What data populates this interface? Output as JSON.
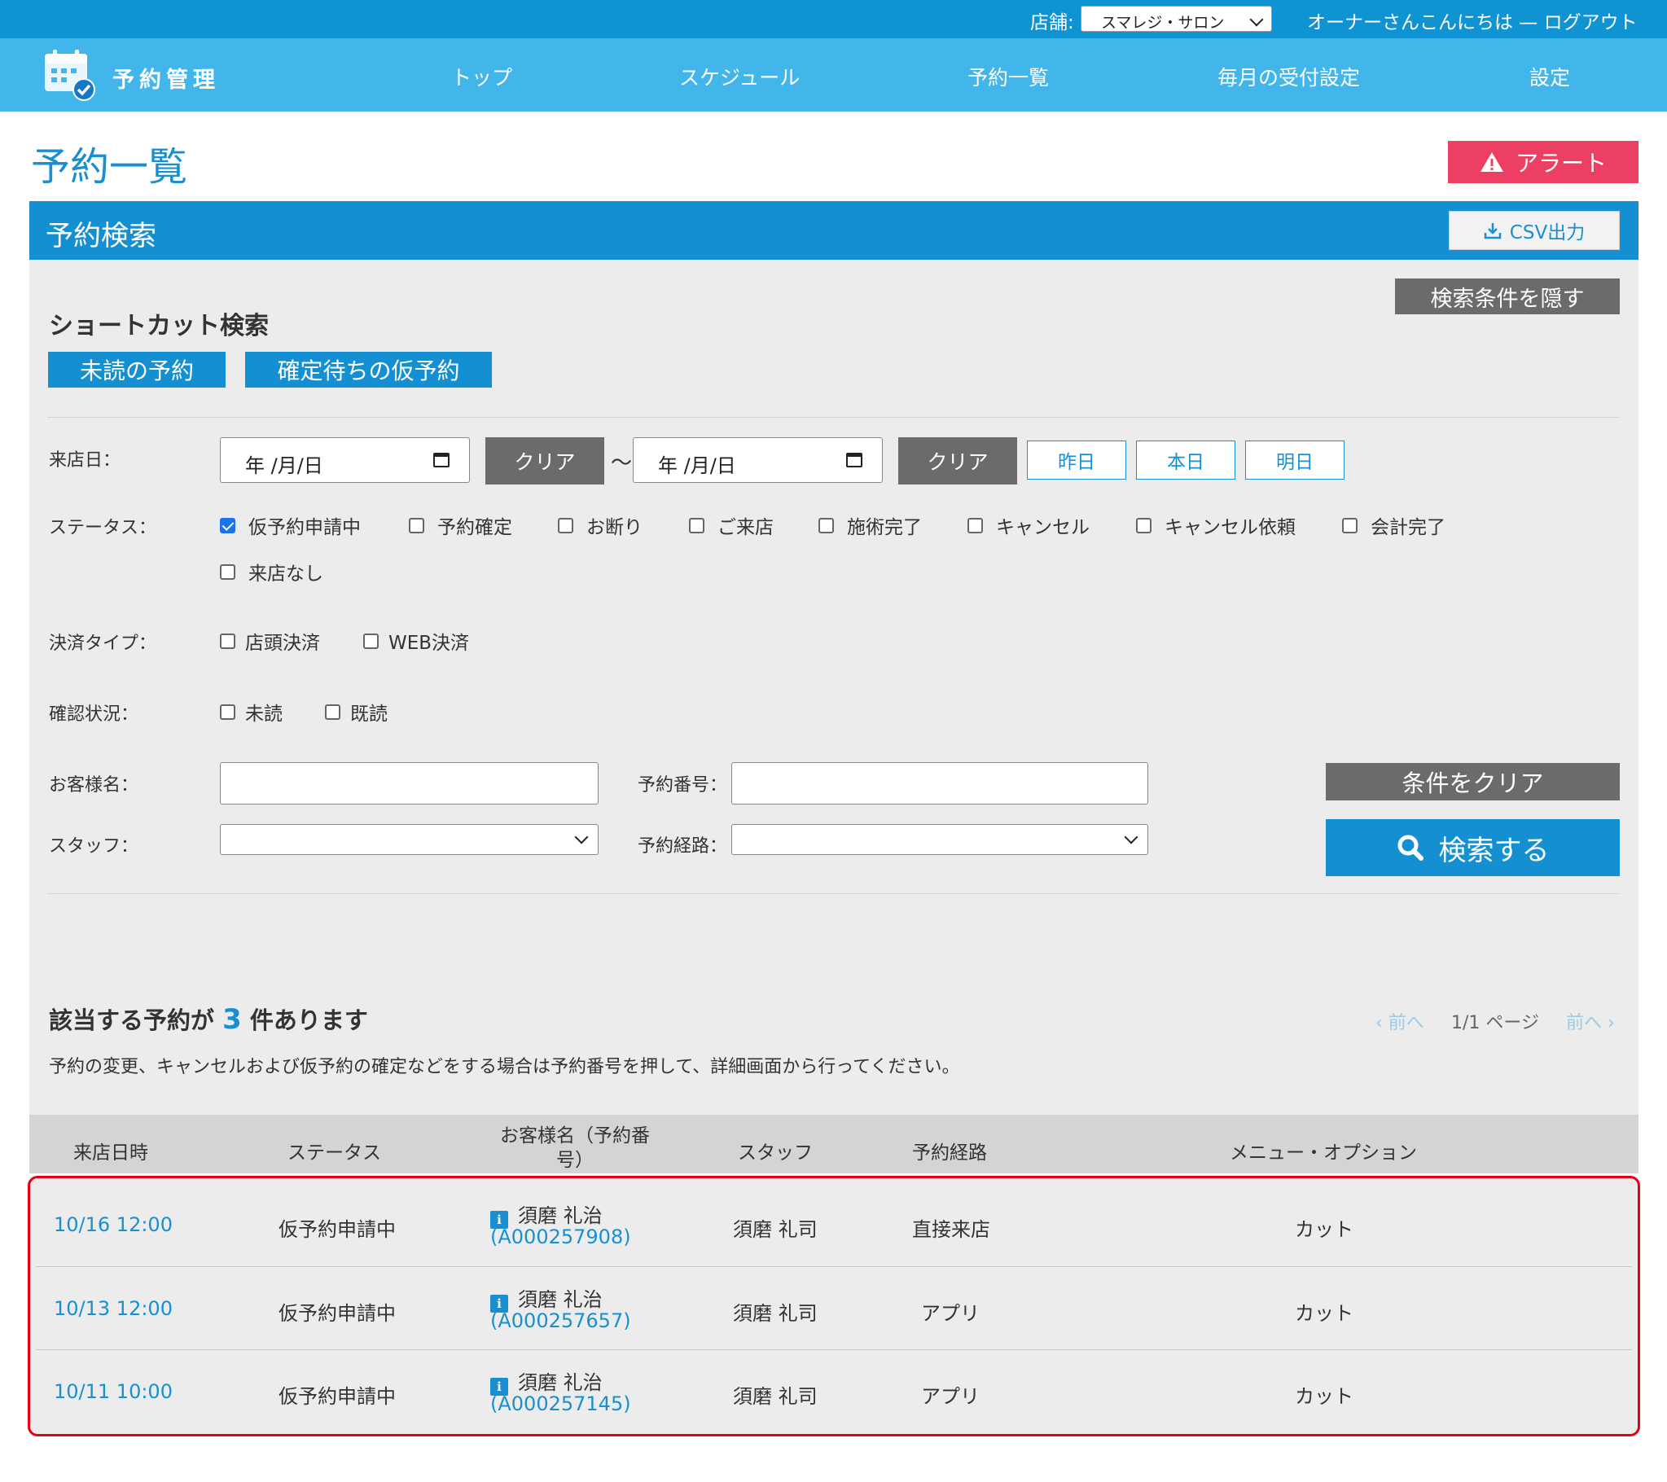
{
  "topbar": {
    "store_label": "店舗:",
    "store_value": "スマレジ・サロン",
    "greeting": "オーナーさんこんにちは — ログアウト"
  },
  "nav": {
    "brand": "予約管理",
    "items": [
      "トップ",
      "スケジュール",
      "予約一覧",
      "毎月の受付設定",
      "設定"
    ]
  },
  "page": {
    "title": "予約一覧",
    "alert_label": "アラート"
  },
  "search": {
    "header": "予約検索",
    "csv_label": "CSV出力",
    "hide_label": "検索条件を隠す",
    "shortcut_title": "ショートカット検索",
    "shortcuts": [
      "未読の予約",
      "確定待ちの仮予約"
    ],
    "visit_date_label": "来店日：",
    "date_placeholder": "年 /月/日",
    "clear_label": "クリア",
    "tilde": "〜",
    "day_buttons": [
      "昨日",
      "本日",
      "明日"
    ],
    "status_label": "ステータス：",
    "statuses": [
      {
        "label": "仮予約申請中",
        "checked": true
      },
      {
        "label": "予約確定",
        "checked": false
      },
      {
        "label": "お断り",
        "checked": false
      },
      {
        "label": "ご来店",
        "checked": false
      },
      {
        "label": "施術完了",
        "checked": false
      },
      {
        "label": "キャンセル",
        "checked": false
      },
      {
        "label": "キャンセル依頼",
        "checked": false
      },
      {
        "label": "会計完了",
        "checked": false
      },
      {
        "label": "来店なし",
        "checked": false
      }
    ],
    "payment_label": "決済タイプ：",
    "payments": [
      "店頭決済",
      "WEB決済"
    ],
    "confirm_label": "確認状況：",
    "confirms": [
      "未読",
      "既読"
    ],
    "customer_label": "お客様名：",
    "customer_value": "",
    "reservation_no_label": "予約番号：",
    "reservation_no_value": "",
    "staff_label": "スタッフ：",
    "staff_value": "",
    "route_label": "予約経路：",
    "route_value": "",
    "clear_conditions_label": "条件をクリア",
    "search_label": "検索する"
  },
  "results": {
    "prefix": "該当する予約が",
    "count": "3",
    "suffix": "件あります",
    "prev": "‹ 前へ",
    "page_info": "1/1 ページ",
    "next": "前へ ›",
    "note": "予約の変更、キャンセルおよび仮予約の確定などをする場合は予約番号を押して、詳細画面から行ってください。",
    "columns": [
      "来店日時",
      "ステータス",
      "お客様名（予約番号）",
      "スタッフ",
      "予約経路",
      "メニュー・オプション"
    ],
    "rows": [
      {
        "datetime": "10/16 12:00",
        "status": "仮予約申請中",
        "customer": "須磨 礼治",
        "number": "(A000257908)",
        "staff": "須磨 礼司",
        "route": "直接来店",
        "menu": "カット"
      },
      {
        "datetime": "10/13 12:00",
        "status": "仮予約申請中",
        "customer": "須磨 礼治",
        "number": "(A000257657)",
        "staff": "須磨 礼司",
        "route": "アプリ",
        "menu": "カット"
      },
      {
        "datetime": "10/11 10:00",
        "status": "仮予約申請中",
        "customer": "須磨 礼治",
        "number": "(A000257145)",
        "staff": "須磨 礼司",
        "route": "アプリ",
        "menu": "カット"
      }
    ]
  },
  "colors": {
    "topbar": "#0f93d2",
    "nav": "#42b6eb",
    "primary": "#1490d2",
    "alert": "#ec3f63",
    "highlight_border": "#e60012"
  }
}
